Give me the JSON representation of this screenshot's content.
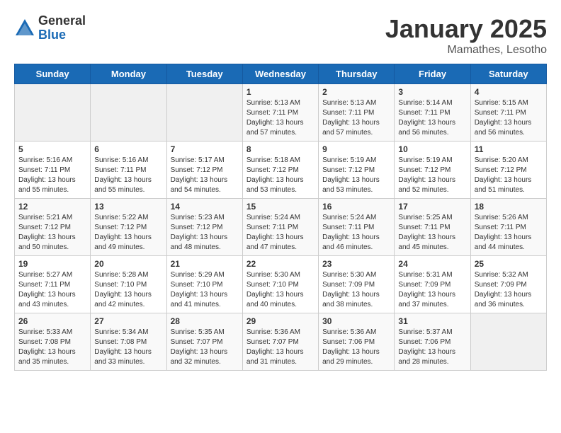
{
  "logo": {
    "general": "General",
    "blue": "Blue"
  },
  "header": {
    "month": "January 2025",
    "location": "Mamathes, Lesotho"
  },
  "weekdays": [
    "Sunday",
    "Monday",
    "Tuesday",
    "Wednesday",
    "Thursday",
    "Friday",
    "Saturday"
  ],
  "weeks": [
    [
      {
        "day": "",
        "sunrise": "",
        "sunset": "",
        "daylight": ""
      },
      {
        "day": "",
        "sunrise": "",
        "sunset": "",
        "daylight": ""
      },
      {
        "day": "",
        "sunrise": "",
        "sunset": "",
        "daylight": ""
      },
      {
        "day": "1",
        "sunrise": "Sunrise: 5:13 AM",
        "sunset": "Sunset: 7:11 PM",
        "daylight": "Daylight: 13 hours and 57 minutes."
      },
      {
        "day": "2",
        "sunrise": "Sunrise: 5:13 AM",
        "sunset": "Sunset: 7:11 PM",
        "daylight": "Daylight: 13 hours and 57 minutes."
      },
      {
        "day": "3",
        "sunrise": "Sunrise: 5:14 AM",
        "sunset": "Sunset: 7:11 PM",
        "daylight": "Daylight: 13 hours and 56 minutes."
      },
      {
        "day": "4",
        "sunrise": "Sunrise: 5:15 AM",
        "sunset": "Sunset: 7:11 PM",
        "daylight": "Daylight: 13 hours and 56 minutes."
      }
    ],
    [
      {
        "day": "5",
        "sunrise": "Sunrise: 5:16 AM",
        "sunset": "Sunset: 7:11 PM",
        "daylight": "Daylight: 13 hours and 55 minutes."
      },
      {
        "day": "6",
        "sunrise": "Sunrise: 5:16 AM",
        "sunset": "Sunset: 7:11 PM",
        "daylight": "Daylight: 13 hours and 55 minutes."
      },
      {
        "day": "7",
        "sunrise": "Sunrise: 5:17 AM",
        "sunset": "Sunset: 7:12 PM",
        "daylight": "Daylight: 13 hours and 54 minutes."
      },
      {
        "day": "8",
        "sunrise": "Sunrise: 5:18 AM",
        "sunset": "Sunset: 7:12 PM",
        "daylight": "Daylight: 13 hours and 53 minutes."
      },
      {
        "day": "9",
        "sunrise": "Sunrise: 5:19 AM",
        "sunset": "Sunset: 7:12 PM",
        "daylight": "Daylight: 13 hours and 53 minutes."
      },
      {
        "day": "10",
        "sunrise": "Sunrise: 5:19 AM",
        "sunset": "Sunset: 7:12 PM",
        "daylight": "Daylight: 13 hours and 52 minutes."
      },
      {
        "day": "11",
        "sunrise": "Sunrise: 5:20 AM",
        "sunset": "Sunset: 7:12 PM",
        "daylight": "Daylight: 13 hours and 51 minutes."
      }
    ],
    [
      {
        "day": "12",
        "sunrise": "Sunrise: 5:21 AM",
        "sunset": "Sunset: 7:12 PM",
        "daylight": "Daylight: 13 hours and 50 minutes."
      },
      {
        "day": "13",
        "sunrise": "Sunrise: 5:22 AM",
        "sunset": "Sunset: 7:12 PM",
        "daylight": "Daylight: 13 hours and 49 minutes."
      },
      {
        "day": "14",
        "sunrise": "Sunrise: 5:23 AM",
        "sunset": "Sunset: 7:12 PM",
        "daylight": "Daylight: 13 hours and 48 minutes."
      },
      {
        "day": "15",
        "sunrise": "Sunrise: 5:24 AM",
        "sunset": "Sunset: 7:11 PM",
        "daylight": "Daylight: 13 hours and 47 minutes."
      },
      {
        "day": "16",
        "sunrise": "Sunrise: 5:24 AM",
        "sunset": "Sunset: 7:11 PM",
        "daylight": "Daylight: 13 hours and 46 minutes."
      },
      {
        "day": "17",
        "sunrise": "Sunrise: 5:25 AM",
        "sunset": "Sunset: 7:11 PM",
        "daylight": "Daylight: 13 hours and 45 minutes."
      },
      {
        "day": "18",
        "sunrise": "Sunrise: 5:26 AM",
        "sunset": "Sunset: 7:11 PM",
        "daylight": "Daylight: 13 hours and 44 minutes."
      }
    ],
    [
      {
        "day": "19",
        "sunrise": "Sunrise: 5:27 AM",
        "sunset": "Sunset: 7:11 PM",
        "daylight": "Daylight: 13 hours and 43 minutes."
      },
      {
        "day": "20",
        "sunrise": "Sunrise: 5:28 AM",
        "sunset": "Sunset: 7:10 PM",
        "daylight": "Daylight: 13 hours and 42 minutes."
      },
      {
        "day": "21",
        "sunrise": "Sunrise: 5:29 AM",
        "sunset": "Sunset: 7:10 PM",
        "daylight": "Daylight: 13 hours and 41 minutes."
      },
      {
        "day": "22",
        "sunrise": "Sunrise: 5:30 AM",
        "sunset": "Sunset: 7:10 PM",
        "daylight": "Daylight: 13 hours and 40 minutes."
      },
      {
        "day": "23",
        "sunrise": "Sunrise: 5:30 AM",
        "sunset": "Sunset: 7:09 PM",
        "daylight": "Daylight: 13 hours and 38 minutes."
      },
      {
        "day": "24",
        "sunrise": "Sunrise: 5:31 AM",
        "sunset": "Sunset: 7:09 PM",
        "daylight": "Daylight: 13 hours and 37 minutes."
      },
      {
        "day": "25",
        "sunrise": "Sunrise: 5:32 AM",
        "sunset": "Sunset: 7:09 PM",
        "daylight": "Daylight: 13 hours and 36 minutes."
      }
    ],
    [
      {
        "day": "26",
        "sunrise": "Sunrise: 5:33 AM",
        "sunset": "Sunset: 7:08 PM",
        "daylight": "Daylight: 13 hours and 35 minutes."
      },
      {
        "day": "27",
        "sunrise": "Sunrise: 5:34 AM",
        "sunset": "Sunset: 7:08 PM",
        "daylight": "Daylight: 13 hours and 33 minutes."
      },
      {
        "day": "28",
        "sunrise": "Sunrise: 5:35 AM",
        "sunset": "Sunset: 7:07 PM",
        "daylight": "Daylight: 13 hours and 32 minutes."
      },
      {
        "day": "29",
        "sunrise": "Sunrise: 5:36 AM",
        "sunset": "Sunset: 7:07 PM",
        "daylight": "Daylight: 13 hours and 31 minutes."
      },
      {
        "day": "30",
        "sunrise": "Sunrise: 5:36 AM",
        "sunset": "Sunset: 7:06 PM",
        "daylight": "Daylight: 13 hours and 29 minutes."
      },
      {
        "day": "31",
        "sunrise": "Sunrise: 5:37 AM",
        "sunset": "Sunset: 7:06 PM",
        "daylight": "Daylight: 13 hours and 28 minutes."
      },
      {
        "day": "",
        "sunrise": "",
        "sunset": "",
        "daylight": ""
      }
    ]
  ]
}
